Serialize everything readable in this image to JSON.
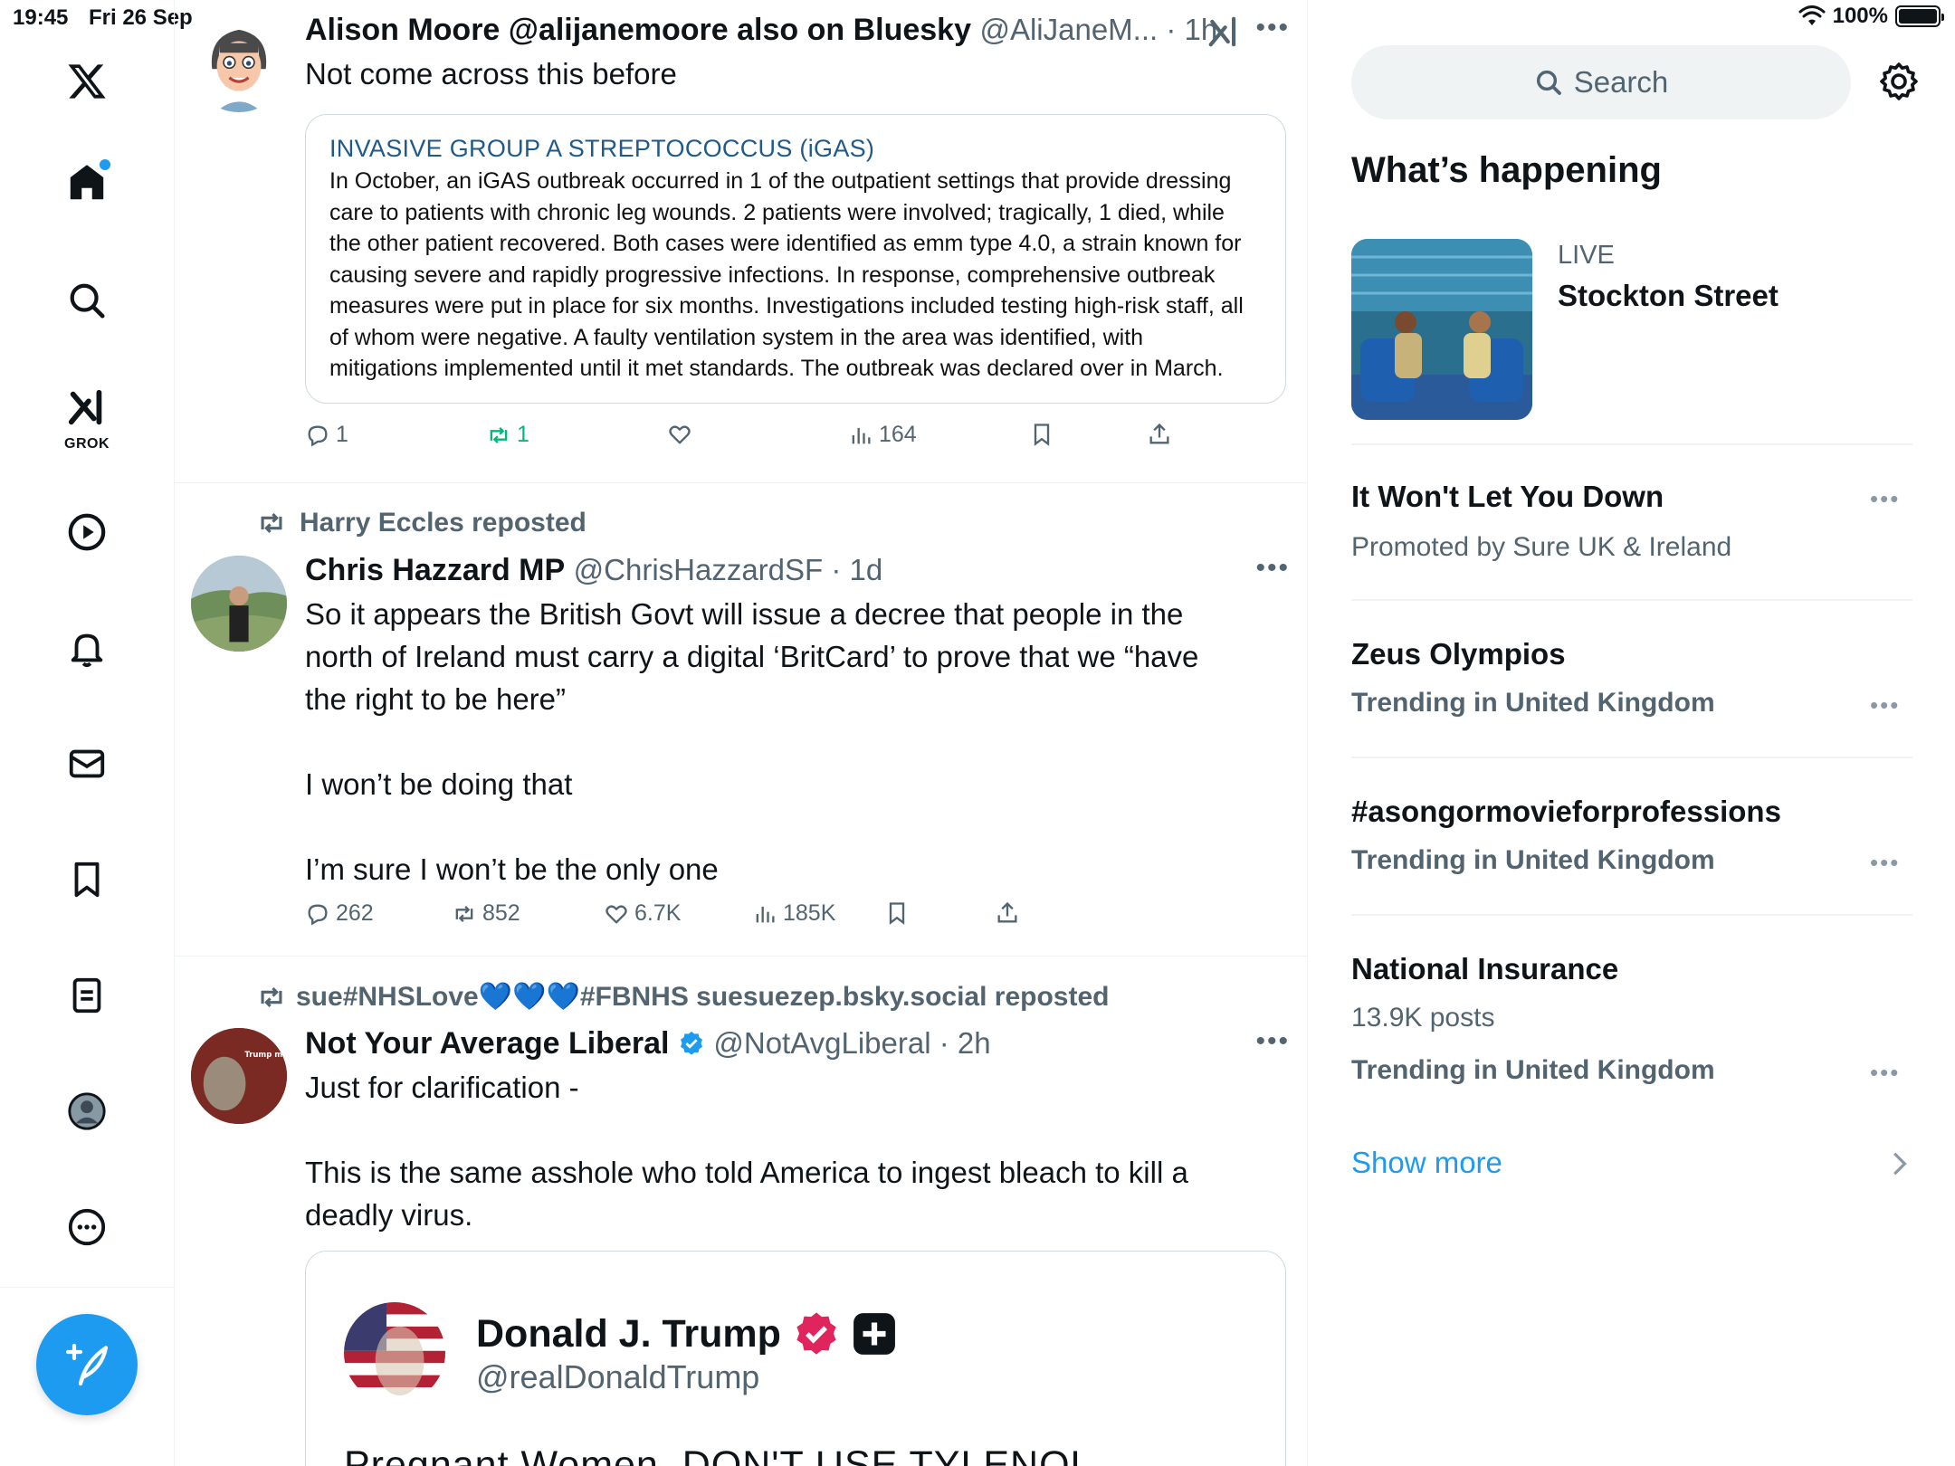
{
  "status_bar": {
    "time": "19:45",
    "date": "Fri 26 Sep",
    "battery": "100%",
    "battery_level": 1.0
  },
  "nav": {
    "grok_label": "GROK"
  },
  "posts": [
    {
      "name": "Alison Moore @alijanemoore also on Bluesky",
      "handle": "@AliJaneM... · 1h",
      "text": "Not come across this before",
      "embed": {
        "title": "INVASIVE GROUP A STREPTOCOCCUS (iGAS)",
        "lines": [
          "In October,  an iGAS outbreak occurred in 1 of the outpatient settings that provide dressing",
          "care to patients with chronic leg wounds. 2 patients were involved; tragically, 1 died, while",
          "the other patient recovered. Both cases were identified as emm type 4.0, a strain known for",
          "causing severe and rapidly progressive infections. In response, comprehensive outbreak",
          "measures were put in place for six months. Investigations included testing high-risk staff, all",
          "of whom were negative. A faulty ventilation system in the area was identified, with",
          "mitigations implemented until it met standards. The outbreak was declared over in March."
        ]
      },
      "actions": {
        "replies": "1",
        "reposts": "1",
        "likes": "",
        "views": "164"
      }
    },
    {
      "repost_by": "Harry Eccles reposted",
      "name": "Chris Hazzard MP",
      "handle": "@ChrisHazzardSF · 1d",
      "text": "So it appears the British Govt will issue a decree that people in the\nnorth of Ireland must carry a digital ‘BritCard’ to prove that we “have\nthe right to be here”\n\nI won’t be doing that\n\nI’m sure I won’t be the only one",
      "actions": {
        "replies": "262",
        "reposts": "852",
        "likes": "6.7K",
        "views": "185K"
      }
    },
    {
      "repost_by_start": "sue#NHSLove",
      "repost_hearts": "💙💙💙",
      "repost_by_end": "#FBNHS suesuezep.bsky.social reposted",
      "name": "Not Your Average Liberal",
      "handle": "@NotAvgLiberal · 2h",
      "text": "Just for clarification -\n\nThis is the same asshole who told America to ingest bleach to kill a\ndeadly virus.",
      "quote": {
        "name": "Donald J. Trump",
        "handle": "@realDonaldTrump",
        "text": "Pregnant Women, DON'T USE TYLENOL"
      },
      "avatar_text": "Trump might be America's Hitler"
    }
  ],
  "sidebar": {
    "search_placeholder": "Search",
    "heading": "What’s happening",
    "live": {
      "tag": "LIVE",
      "title": "Stockton Street"
    },
    "trends": [
      {
        "title": "It Won't Let You Down",
        "meta": "Promoted by Sure UK & Ireland"
      },
      {
        "title": "Zeus Olympios",
        "meta": "Trending in United Kingdom"
      },
      {
        "title": "#asongormovieforprofessions",
        "meta": "Trending in United Kingdom"
      },
      {
        "title": "National Insurance",
        "count": "13.9K posts",
        "meta": "Trending in United Kingdom"
      }
    ],
    "show_more": "Show more"
  }
}
